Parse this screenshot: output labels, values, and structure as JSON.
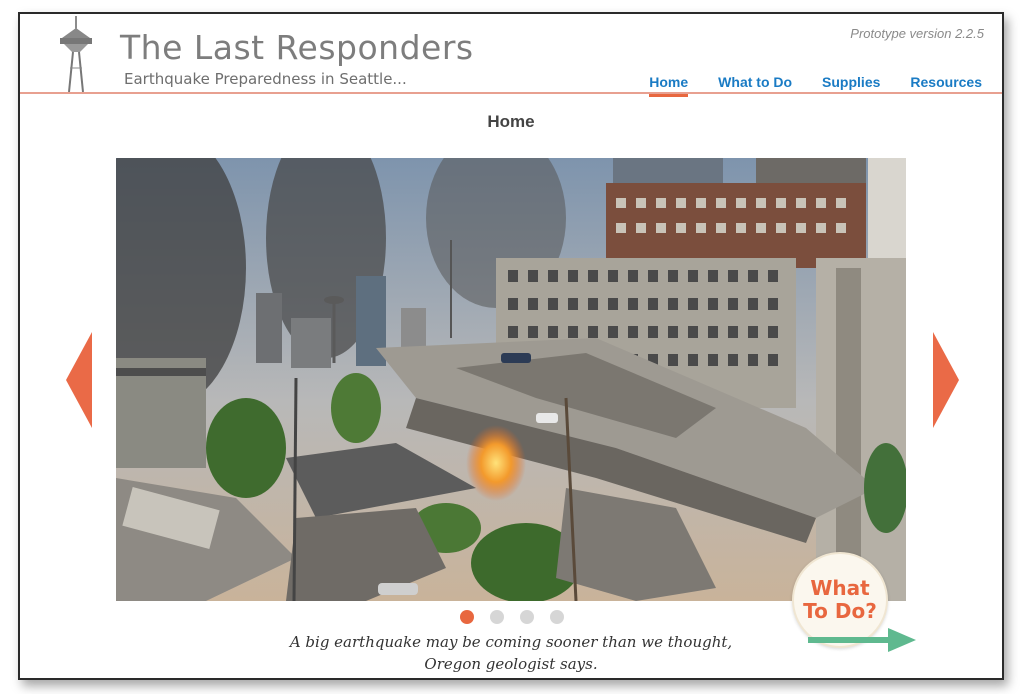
{
  "header": {
    "title": "The Last Responders",
    "subtitle": "Earthquake Preparedness in Seattle...",
    "version": "Prototype version 2.2.5",
    "logo_icon": "space-needle-icon"
  },
  "nav": {
    "items": [
      {
        "label": "Home",
        "active": true
      },
      {
        "label": "What to Do",
        "active": false
      },
      {
        "label": "Supplies",
        "active": false
      },
      {
        "label": "Resources",
        "active": false
      }
    ]
  },
  "page": {
    "title": "Home"
  },
  "carousel": {
    "prev_icon": "arrow-left-icon",
    "next_icon": "arrow-right-icon",
    "slide_count": 4,
    "active_slide": 1,
    "caption_line1": "A big earthquake may be coming sooner than we thought,",
    "caption_line2": "Oregon geologist says."
  },
  "cta": {
    "line1": "What",
    "line2": "To Do?",
    "icon": "arrow-right-icon"
  },
  "colors": {
    "accent": "#e8673f",
    "link": "#1a7bc4",
    "cta_arrow": "#5fb98f"
  }
}
